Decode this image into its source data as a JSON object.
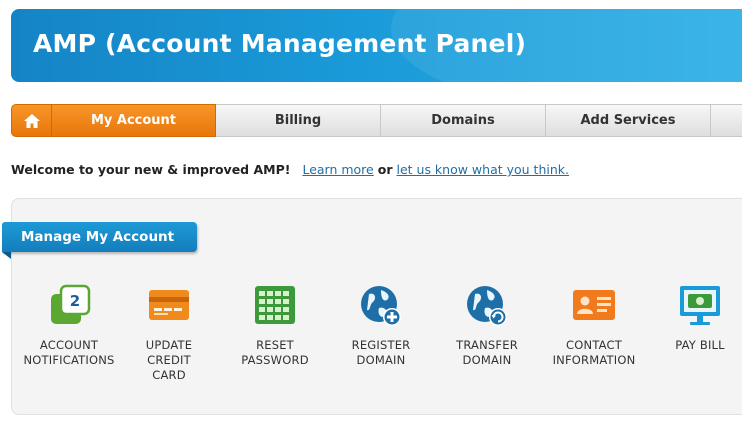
{
  "header": {
    "title": "AMP (Account Management Panel)"
  },
  "tabs": [
    {
      "icon": "home-icon"
    },
    {
      "label": "My Account",
      "active": true
    },
    {
      "label": "Billing"
    },
    {
      "label": "Domains"
    },
    {
      "label": "Add Services"
    }
  ],
  "welcome": {
    "text": "Welcome to your new & improved AMP!",
    "learn_more": "Learn more",
    "or": "or",
    "feedback": "let us know what you think."
  },
  "panel": {
    "title": "Manage My Account",
    "items": [
      {
        "icon": "notifications-icon",
        "label": "Account Notifications",
        "badge": "2"
      },
      {
        "icon": "credit-card-icon",
        "label": "Update Credit Card"
      },
      {
        "icon": "reset-password-icon",
        "label": "Reset Password"
      },
      {
        "icon": "register-domain-icon",
        "label": "Register Domain"
      },
      {
        "icon": "transfer-domain-icon",
        "label": "Transfer Domain"
      },
      {
        "icon": "contact-card-icon",
        "label": "Contact Information"
      },
      {
        "icon": "pay-bill-icon",
        "label": "Pay Bill"
      }
    ]
  },
  "colors": {
    "accent_orange": "#e87709",
    "brand_blue": "#1a9ad8",
    "link": "#1f6fa8"
  }
}
